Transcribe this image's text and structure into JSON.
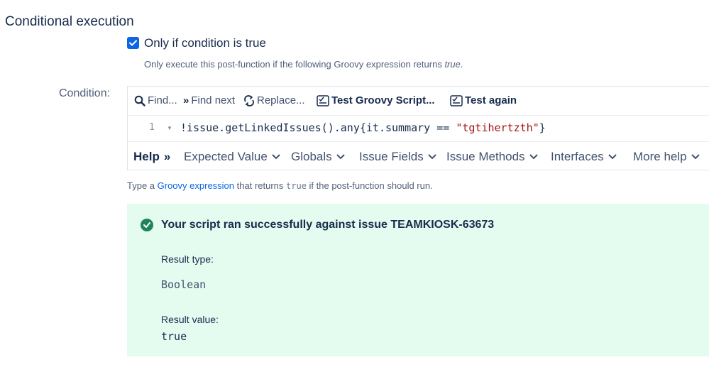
{
  "section": {
    "title": "Conditional execution"
  },
  "option": {
    "checkbox_label": "Only if condition is true",
    "description_prefix": "Only execute this post-function if the following Groovy expression returns ",
    "description_emph": "true",
    "description_suffix": "."
  },
  "condition": {
    "label": "Condition:",
    "toolbar": {
      "find": "Find...",
      "find_next": "Find next",
      "replace": "Replace...",
      "test_script": "Test Groovy Script...",
      "test_again": "Test again"
    },
    "line_number": "1",
    "code_prefix": "!issue.getLinkedIssues().any{it.summary == ",
    "code_string": "\"tgtihertzth\"",
    "code_suffix": "}",
    "help": {
      "label": "Help",
      "items": [
        "Expected Value",
        "Globals",
        "Issue Fields",
        "Issue Methods",
        "Interfaces",
        "More help"
      ]
    }
  },
  "hint": {
    "prefix": "Type a ",
    "link": "Groovy expression",
    "middle": " that returns ",
    "code": "true",
    "suffix": " if the post-function should run."
  },
  "result": {
    "title": "Your script ran successfully against issue TEAMKIOSK-63673",
    "type_label": "Result type:",
    "type_value": "Boolean",
    "value_label": "Result value:",
    "value_value": "true"
  },
  "colors": {
    "accent": "#0c66e4",
    "success_bg": "#e3fcef",
    "success_icon": "#1f845a",
    "string_literal": "#a31515"
  }
}
